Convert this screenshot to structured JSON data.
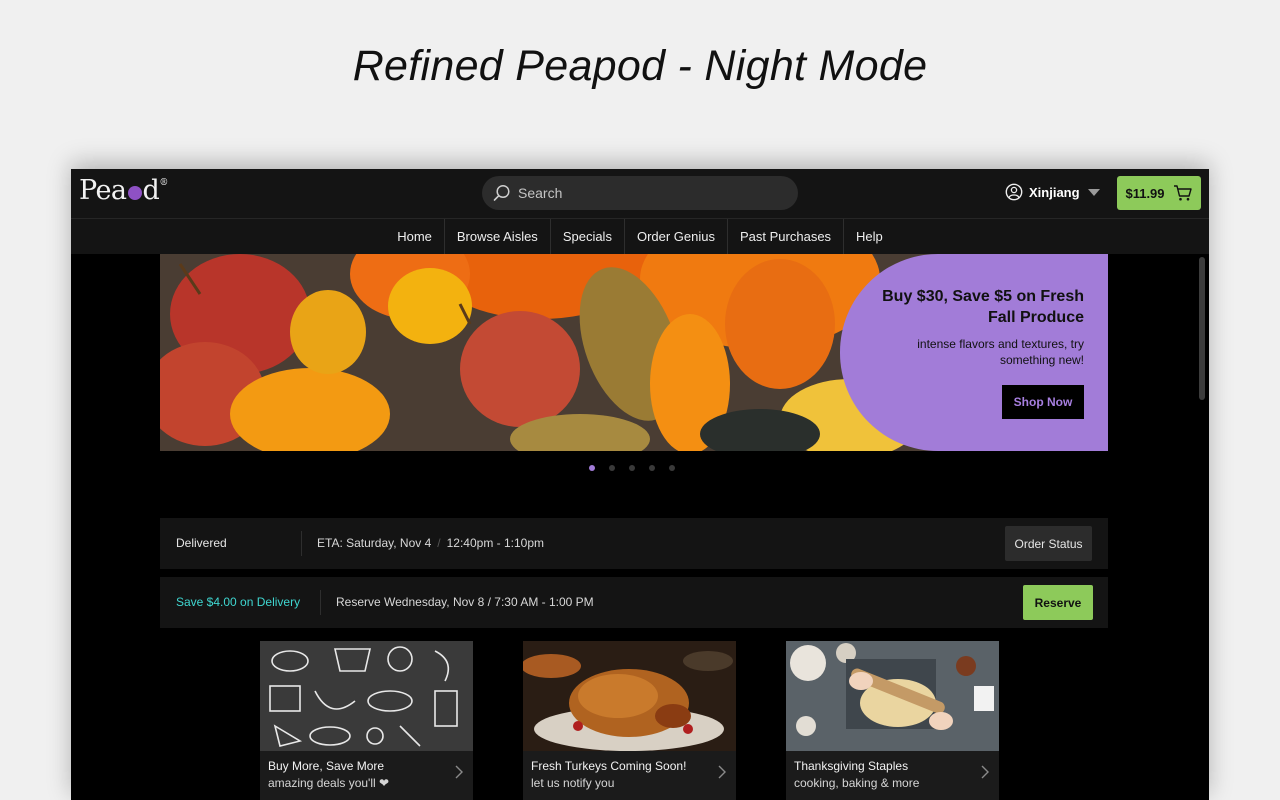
{
  "page_heading": "Refined Peapod - Night Mode",
  "header": {
    "logo_text_before": "Pea",
    "logo_text_after": "d",
    "logo_reg": "®",
    "search_placeholder": "Search",
    "user_name": "Xinjiang",
    "cart_total": "$11.99"
  },
  "nav": {
    "items": [
      "Home",
      "Browse Aisles",
      "Specials",
      "Order Genius",
      "Past Purchases",
      "Help"
    ]
  },
  "hero": {
    "title": "Buy $30, Save $5 on Fresh Fall Produce",
    "subtitle": "intense flavors and textures, try something new!",
    "cta": "Shop Now",
    "accent_color": "#a27cd8",
    "slide_count": 5,
    "active_slide": 1
  },
  "order": {
    "status": "Delivered",
    "eta": "ETA: Saturday, Nov 4",
    "time": "12:40pm - 1:10pm",
    "status_button": "Order Status"
  },
  "delivery": {
    "promo": "Save $4.00 on Delivery",
    "reserve_text": "Reserve Wednesday, Nov 8 / 7:30 AM - 1:00 PM",
    "reserve_button": "Reserve",
    "promo_color": "#3fd6d0"
  },
  "cards": [
    {
      "title": "Buy More, Save More",
      "subtitle": "amazing deals you'll ❤"
    },
    {
      "title": "Fresh Turkeys Coming Soon!",
      "subtitle": "let us notify you"
    },
    {
      "title": "Thanksgiving Staples",
      "subtitle": "cooking, baking & more"
    }
  ],
  "colors": {
    "background": "#000000",
    "bar": "#141414",
    "green": "#8dca5a",
    "purple": "#8e51c4"
  },
  "icons": [
    "search-icon",
    "user-icon",
    "cart-icon",
    "chevron-right-icon",
    "heart-icon"
  ]
}
